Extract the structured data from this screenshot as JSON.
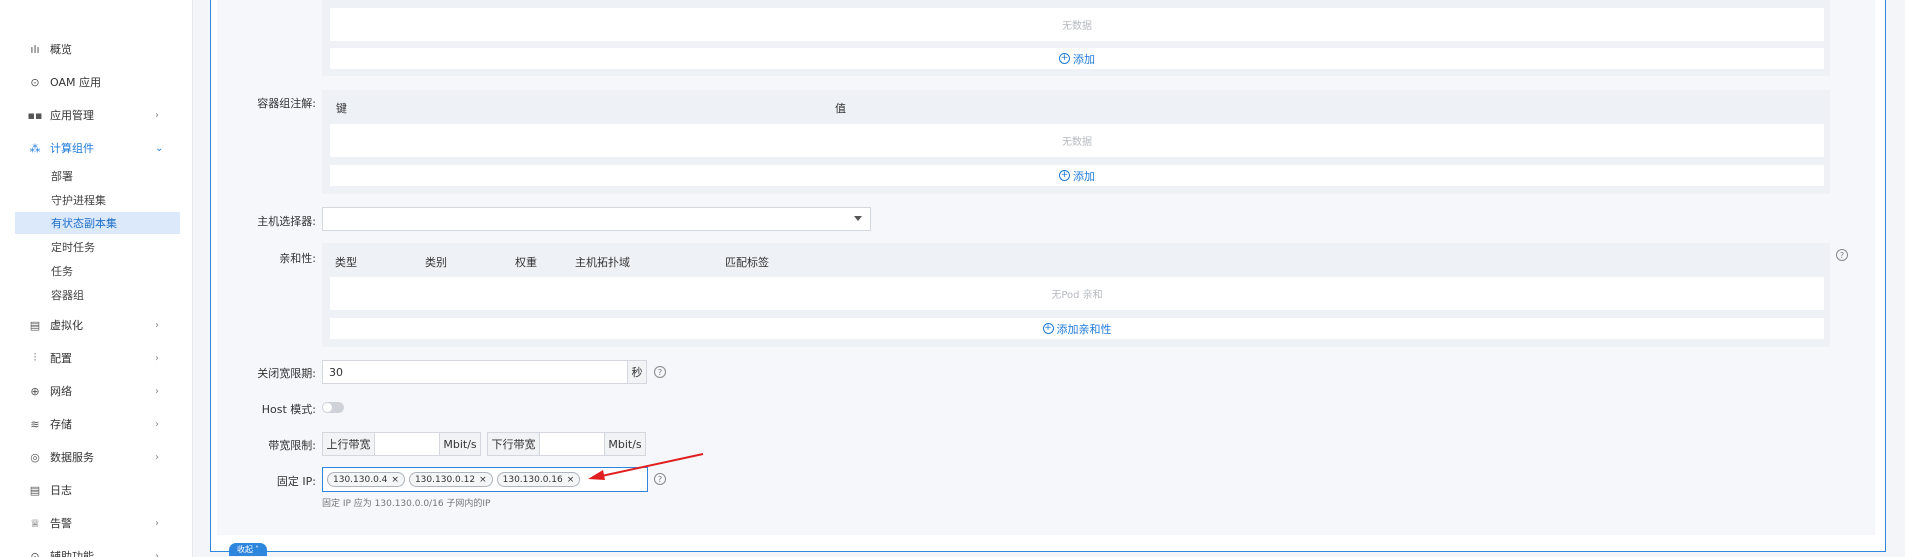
{
  "sidebar": {
    "items": [
      {
        "label": "概览",
        "icon": "bar-chart-icon",
        "glyph": "ılı"
      },
      {
        "label": "OAM 应用",
        "icon": "settings-cycle-icon",
        "glyph": "⊙"
      },
      {
        "label": "应用管理",
        "icon": "grid-icon",
        "glyph": "▪▪"
      },
      {
        "label": "计算组件",
        "icon": "hierarchy-icon",
        "glyph": "⁂"
      },
      {
        "label": "虚拟化",
        "icon": "document-edit-icon",
        "glyph": "▤"
      },
      {
        "label": "配置",
        "icon": "sliders-icon",
        "glyph": "⫶"
      },
      {
        "label": "网络",
        "icon": "globe-icon",
        "glyph": "⊕"
      },
      {
        "label": "存储",
        "icon": "database-icon",
        "glyph": "≋"
      },
      {
        "label": "数据服务",
        "icon": "data-service-icon",
        "glyph": "◎"
      },
      {
        "label": "日志",
        "icon": "log-icon",
        "glyph": "▤"
      },
      {
        "label": "告警",
        "icon": "alarm-icon",
        "glyph": "♕"
      },
      {
        "label": "辅助功能",
        "icon": "assist-icon",
        "glyph": "⊙"
      }
    ],
    "sub_items": [
      "部署",
      "守护进程集",
      "有状态副本集",
      "定时任务",
      "任务",
      "容器组"
    ]
  },
  "form": {
    "top_section": {
      "empty_text": "无数据",
      "add_label": "添加"
    },
    "annotations": {
      "label": "容器组注解:",
      "col_key": "键",
      "col_value": "值",
      "empty_text": "无数据",
      "add_label": "添加"
    },
    "host_selector": {
      "label": "主机选择器:",
      "value": ""
    },
    "affinity": {
      "label": "亲和性:",
      "columns": [
        "类型",
        "类别",
        "权重",
        "主机拓扑域",
        "匹配标签"
      ],
      "empty_text": "无Pod 亲和",
      "add_label": "添加亲和性"
    },
    "grace_period": {
      "label": "关闭宽限期:",
      "value": "30",
      "unit": "秒"
    },
    "host_mode": {
      "label": "Host 模式:",
      "enabled": false
    },
    "bandwidth": {
      "label": "带宽限制:",
      "upload_label": "上行带宽",
      "download_label": "下行带宽",
      "unit": "Mbit/s",
      "upload_value": "",
      "download_value": ""
    },
    "fixed_ip": {
      "label": "固定 IP:",
      "tags": [
        "130.130.0.4",
        "130.130.0.12",
        "130.130.0.16"
      ],
      "hint": "固定 IP 应为 130.130.0.0/16 子网内的IP"
    },
    "collapse_label": "收起"
  },
  "colors": {
    "accent": "#2f86dd",
    "arrow": "#e02020"
  }
}
